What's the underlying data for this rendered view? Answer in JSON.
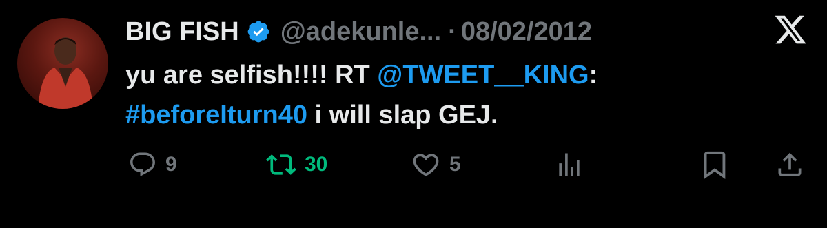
{
  "tweet": {
    "display_name": "BIG FISH",
    "handle": "@adekunle...",
    "separator": "·",
    "date": "08/02/2012",
    "text_part1": "yu are selfish!!!! RT ",
    "mention": "@TWEET__KING",
    "text_part2": ":",
    "hashtag": "#beforeIturn40",
    "text_part3": " i will slap GEJ."
  },
  "actions": {
    "replies": "9",
    "retweets": "30",
    "likes": "5"
  },
  "colors": {
    "background": "#000000",
    "primary_text": "#e7e9ea",
    "secondary_text": "#71767b",
    "link": "#1d9bf0",
    "retweeted": "#00ba7c",
    "verified_badge": "#1d9bf0"
  },
  "icons": [
    "verified-badge-icon",
    "x-logo-icon",
    "reply-icon",
    "retweet-icon",
    "like-icon",
    "views-icon",
    "bookmark-icon",
    "share-icon"
  ]
}
